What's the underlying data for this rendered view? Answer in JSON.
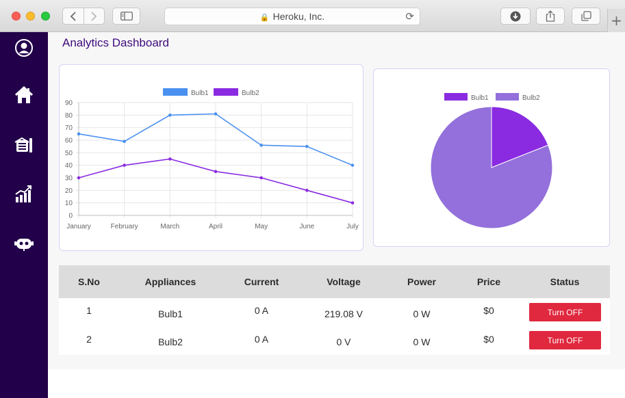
{
  "browser": {
    "site_name": "Heroku, Inc.",
    "icons": [
      "back-icon",
      "forward-icon",
      "sidebar-toggle-icon",
      "lock-icon",
      "reload-icon",
      "download-icon",
      "share-icon",
      "tabs-icon",
      "plus-icon"
    ]
  },
  "sidebar": {
    "items": [
      {
        "icon": "user-circle-icon"
      },
      {
        "icon": "home-icon"
      },
      {
        "icon": "devices-icon"
      },
      {
        "icon": "analytics-icon"
      },
      {
        "icon": "support-bot-icon"
      }
    ]
  },
  "page": {
    "title": "Analytics Dashboard"
  },
  "colors": {
    "sidebar_bg": "#22004a",
    "bulb1_line": "#4a90f0",
    "bulb2_line": "#8a2be2",
    "pie_bulb1": "#8a2be2",
    "pie_bulb2": "#9370db",
    "button_red": "#e0283e",
    "title": "#3e0a7a"
  },
  "chart_data": [
    {
      "type": "line",
      "categories": [
        "January",
        "February",
        "March",
        "April",
        "May",
        "June",
        "July"
      ],
      "series": [
        {
          "name": "Bulb1",
          "values": [
            65,
            59,
            80,
            81,
            56,
            55,
            40
          ],
          "color": "#4a90f0"
        },
        {
          "name": "Bulb2",
          "values": [
            30,
            40,
            45,
            35,
            30,
            20,
            10
          ],
          "color": "#8a2be2"
        }
      ],
      "yticks": [
        0,
        10,
        20,
        30,
        40,
        50,
        60,
        70,
        80,
        90
      ],
      "ylim": [
        0,
        90
      ],
      "grid": true,
      "legend": "top-center"
    },
    {
      "type": "pie",
      "labels": [
        "Bulb1",
        "Bulb2"
      ],
      "values": [
        19,
        81
      ],
      "colors": [
        "#8a2be2",
        "#9370db"
      ],
      "legend": "top-center"
    }
  ],
  "table": {
    "headers": [
      "S.No",
      "Appliances",
      "Current",
      "Voltage",
      "Power",
      "Price",
      "Status"
    ],
    "rows": [
      {
        "sno": "1",
        "appliance": "Bulb1",
        "current": "0 A",
        "voltage": "219.08 V",
        "power": "0 W",
        "price": "$0",
        "action": "Turn OFF"
      },
      {
        "sno": "2",
        "appliance": "Bulb2",
        "current": "0 A",
        "voltage": "0 V",
        "power": "0 W",
        "price": "$0",
        "action": "Turn OFF"
      }
    ]
  }
}
